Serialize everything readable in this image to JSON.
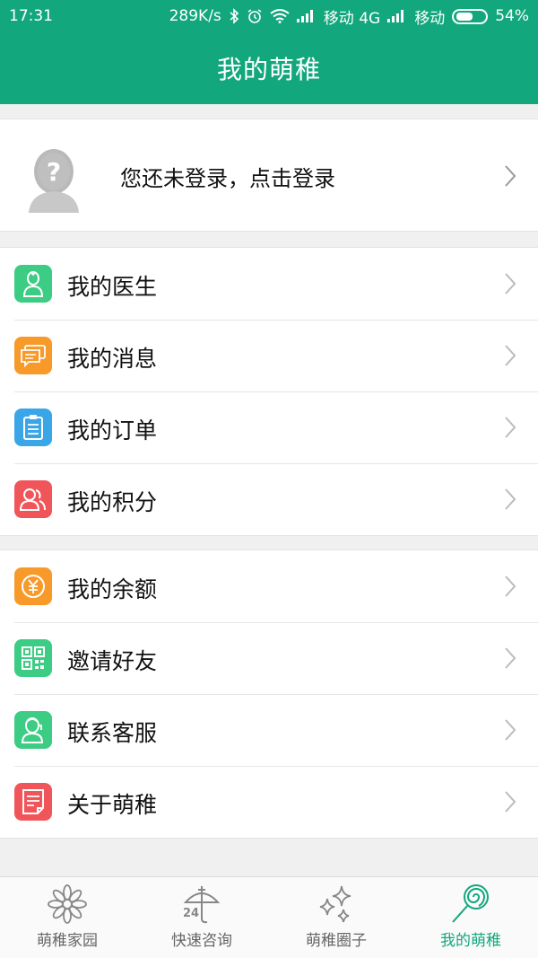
{
  "status_bar": {
    "time": "17:31",
    "speed": "289K/s",
    "carrier1": "移动 4G",
    "carrier2": "移动",
    "battery": "54%"
  },
  "header": {
    "title": "我的萌稚"
  },
  "login": {
    "text": "您还未登录，点击登录"
  },
  "menu_group1": [
    {
      "label": "我的医生",
      "icon": "doctor-icon",
      "color": "#3dcc84"
    },
    {
      "label": "我的消息",
      "icon": "message-icon",
      "color": "#f79a2a"
    },
    {
      "label": "我的订单",
      "icon": "order-icon",
      "color": "#3aa6e8"
    },
    {
      "label": "我的积分",
      "icon": "points-icon",
      "color": "#f0555a"
    }
  ],
  "menu_group2": [
    {
      "label": "我的余额",
      "icon": "balance-icon",
      "color": "#f79a2a"
    },
    {
      "label": "邀请好友",
      "icon": "qrcode-icon",
      "color": "#3dcc84"
    },
    {
      "label": "联系客服",
      "icon": "service-icon",
      "color": "#3dcc84"
    },
    {
      "label": "关于萌稚",
      "icon": "about-icon",
      "color": "#f0555a"
    }
  ],
  "tabs": [
    {
      "label": "萌稚家园",
      "icon": "flower-icon",
      "active": false
    },
    {
      "label": "快速咨询",
      "icon": "umbrella-24-icon",
      "active": false
    },
    {
      "label": "萌稚圈子",
      "icon": "sparkle-icon",
      "active": false
    },
    {
      "label": "我的萌稚",
      "icon": "lollipop-icon",
      "active": true
    }
  ],
  "tab_icon_text": "24",
  "colors": {
    "primary": "#13a77d",
    "inactive_tab": "#666666"
  }
}
